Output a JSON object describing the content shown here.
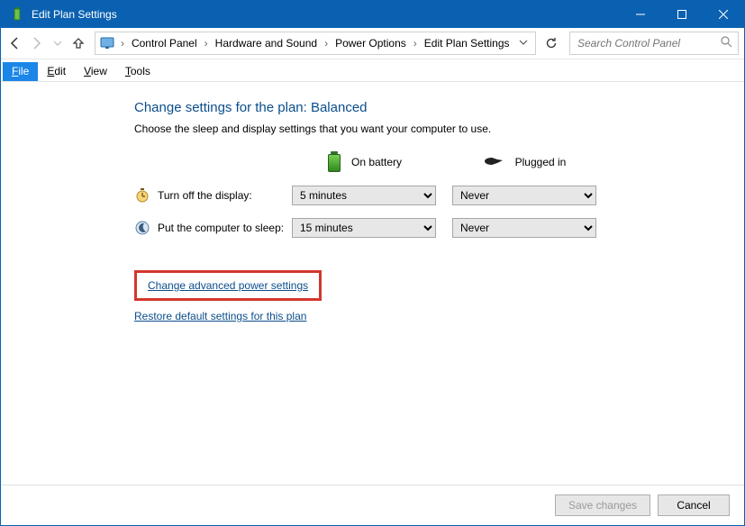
{
  "titlebar": {
    "title": "Edit Plan Settings"
  },
  "breadcrumb": {
    "items": [
      "Control Panel",
      "Hardware and Sound",
      "Power Options",
      "Edit Plan Settings"
    ]
  },
  "search": {
    "placeholder": "Search Control Panel"
  },
  "menubar": {
    "file": "File",
    "edit": "Edit",
    "view": "View",
    "tools": "Tools"
  },
  "page": {
    "heading": "Change settings for the plan: Balanced",
    "subtext": "Choose the sleep and display settings that you want your computer to use.",
    "col_battery": "On battery",
    "col_plugged": "Plugged in",
    "row_display": "Turn off the display:",
    "row_sleep": "Put the computer to sleep:",
    "display_battery": "5 minutes",
    "display_plugged": "Never",
    "sleep_battery": "15 minutes",
    "sleep_plugged": "Never",
    "link_advanced": "Change advanced power settings",
    "link_restore": "Restore default settings for this plan"
  },
  "footer": {
    "save": "Save changes",
    "cancel": "Cancel"
  }
}
